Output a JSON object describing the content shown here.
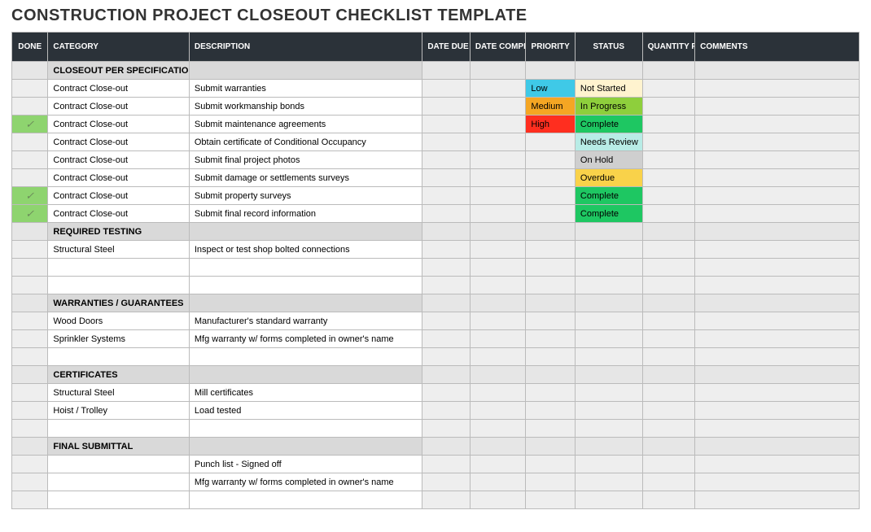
{
  "title": "CONSTRUCTION PROJECT CLOSEOUT CHECKLIST TEMPLATE",
  "headers": {
    "done": "DONE",
    "category": "CATEGORY",
    "description": "DESCRIPTION",
    "date_due": "DATE DUE",
    "date_completed": "DATE COMPLETED",
    "priority": "PRIORITY",
    "status": "STATUS",
    "quantity_requested": "QUANTITY REQUESTED",
    "comments": "COMMENTS"
  },
  "check_glyph": "✓",
  "sections": [
    {
      "label": "CLOSEOUT PER SPECIFICATION",
      "rows": [
        {
          "done": false,
          "category": "Contract Close-out",
          "description": "Submit warranties",
          "date_due": "",
          "date_completed": "",
          "priority": "Low",
          "status": "Not Started",
          "quantity_requested": "",
          "comments": ""
        },
        {
          "done": false,
          "category": "Contract Close-out",
          "description": "Submit workmanship bonds",
          "date_due": "",
          "date_completed": "",
          "priority": "Medium",
          "status": "In Progress",
          "quantity_requested": "",
          "comments": ""
        },
        {
          "done": true,
          "category": "Contract Close-out",
          "description": "Submit maintenance agreements",
          "date_due": "",
          "date_completed": "",
          "priority": "High",
          "status": "Complete",
          "quantity_requested": "",
          "comments": ""
        },
        {
          "done": false,
          "category": "Contract Close-out",
          "description": "Obtain certificate of Conditional Occupancy",
          "date_due": "",
          "date_completed": "",
          "priority": "",
          "status": "Needs Review",
          "quantity_requested": "",
          "comments": ""
        },
        {
          "done": false,
          "category": "Contract Close-out",
          "description": "Submit final project photos",
          "date_due": "",
          "date_completed": "",
          "priority": "",
          "status": "On Hold",
          "quantity_requested": "",
          "comments": ""
        },
        {
          "done": false,
          "category": "Contract Close-out",
          "description": "Submit damage or settlements surveys",
          "date_due": "",
          "date_completed": "",
          "priority": "",
          "status": "Overdue",
          "quantity_requested": "",
          "comments": ""
        },
        {
          "done": true,
          "category": "Contract Close-out",
          "description": "Submit property surveys",
          "date_due": "",
          "date_completed": "",
          "priority": "",
          "status": "Complete",
          "quantity_requested": "",
          "comments": ""
        },
        {
          "done": true,
          "category": "Contract Close-out",
          "description": "Submit final record information",
          "date_due": "",
          "date_completed": "",
          "priority": "",
          "status": "Complete",
          "quantity_requested": "",
          "comments": ""
        }
      ]
    },
    {
      "label": "REQUIRED TESTING",
      "rows": [
        {
          "done": false,
          "category": "Structural Steel",
          "description": "Inspect or test shop bolted connections",
          "date_due": "",
          "date_completed": "",
          "priority": "",
          "status": "",
          "quantity_requested": "",
          "comments": ""
        },
        {
          "done": false,
          "category": "",
          "description": "",
          "date_due": "",
          "date_completed": "",
          "priority": "",
          "status": "",
          "quantity_requested": "",
          "comments": ""
        },
        {
          "done": false,
          "category": "",
          "description": "",
          "date_due": "",
          "date_completed": "",
          "priority": "",
          "status": "",
          "quantity_requested": "",
          "comments": ""
        }
      ]
    },
    {
      "label": "WARRANTIES / GUARANTEES",
      "rows": [
        {
          "done": false,
          "category": "Wood Doors",
          "description": "Manufacturer's standard warranty",
          "date_due": "",
          "date_completed": "",
          "priority": "",
          "status": "",
          "quantity_requested": "",
          "comments": ""
        },
        {
          "done": false,
          "category": "Sprinkler Systems",
          "description": "Mfg warranty w/ forms completed in owner's name",
          "date_due": "",
          "date_completed": "",
          "priority": "",
          "status": "",
          "quantity_requested": "",
          "comments": ""
        },
        {
          "done": false,
          "category": "",
          "description": "",
          "date_due": "",
          "date_completed": "",
          "priority": "",
          "status": "",
          "quantity_requested": "",
          "comments": ""
        }
      ]
    },
    {
      "label": "CERTIFICATES",
      "rows": [
        {
          "done": false,
          "category": "Structural Steel",
          "description": "Mill certificates",
          "date_due": "",
          "date_completed": "",
          "priority": "",
          "status": "",
          "quantity_requested": "",
          "comments": ""
        },
        {
          "done": false,
          "category": "Hoist / Trolley",
          "description": "Load tested",
          "date_due": "",
          "date_completed": "",
          "priority": "",
          "status": "",
          "quantity_requested": "",
          "comments": ""
        },
        {
          "done": false,
          "category": "",
          "description": "",
          "date_due": "",
          "date_completed": "",
          "priority": "",
          "status": "",
          "quantity_requested": "",
          "comments": ""
        }
      ]
    },
    {
      "label": "FINAL SUBMITTAL",
      "rows": [
        {
          "done": false,
          "category": "",
          "description": "Punch list - Signed off",
          "date_due": "",
          "date_completed": "",
          "priority": "",
          "status": "",
          "quantity_requested": "",
          "comments": ""
        },
        {
          "done": false,
          "category": "",
          "description": "Mfg warranty w/ forms completed in owner's name",
          "date_due": "",
          "date_completed": "",
          "priority": "",
          "status": "",
          "quantity_requested": "",
          "comments": ""
        },
        {
          "done": false,
          "category": "",
          "description": "",
          "date_due": "",
          "date_completed": "",
          "priority": "",
          "status": "",
          "quantity_requested": "",
          "comments": ""
        }
      ]
    }
  ]
}
